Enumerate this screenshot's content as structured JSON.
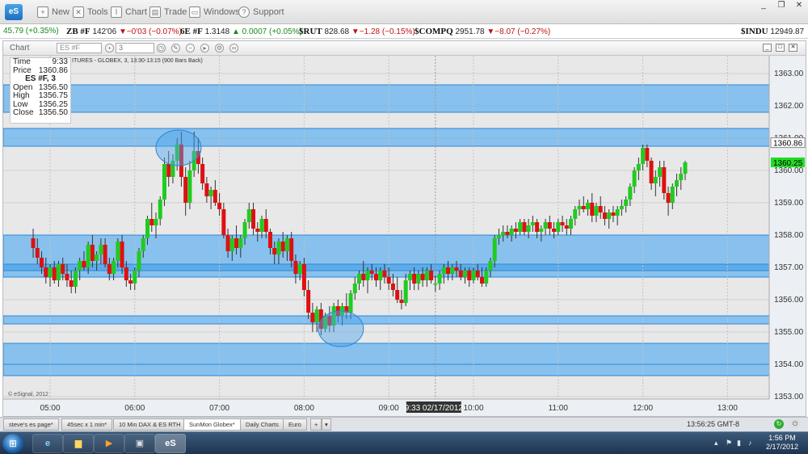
{
  "app": {
    "logo_text": "eS"
  },
  "toolbar": {
    "items": [
      {
        "label": "New",
        "icon": "new-file-icon"
      },
      {
        "label": "Tools",
        "icon": "tools-icon"
      },
      {
        "label": "Chart",
        "icon": "chart-icon"
      },
      {
        "label": "Trade",
        "icon": "trade-icon"
      },
      {
        "label": "Windows",
        "icon": "windows-icon"
      },
      {
        "label": "Support",
        "icon": "help-icon"
      }
    ]
  },
  "ticker": [
    {
      "symbol": "",
      "last": "",
      "change": "45.79 (+0.35%)",
      "dir": "up"
    },
    {
      "symbol": "ZB #F",
      "last": "142'06",
      "change": "▼−0'03 (−0.07%)",
      "dir": "dn"
    },
    {
      "symbol": "6E #F",
      "last": "1.3148",
      "change": "▲ 0.0007 (+0.05%)",
      "dir": "up"
    },
    {
      "symbol": "$RUT",
      "last": "828.68",
      "change": "▼−1.28 (−0.15%)",
      "dir": "dn"
    },
    {
      "symbol": "$COMPQ",
      "last": "2951.78",
      "change": "▼−8.07 (−0.27%)",
      "dir": "dn"
    },
    {
      "symbol": "$INDU",
      "last": "12949.87",
      "change": "",
      "dir": "up"
    }
  ],
  "chart_window": {
    "title": "Chart",
    "symbol": "ES #F",
    "interval": "3",
    "subtitle": "ITURES - GLOBEX, 3, 13:30-13:15 (900 Bars Back)",
    "copyright": "© eSignal, 2012",
    "cursor_label": "9:33 02/17/2012",
    "last_price_label": "1360.25",
    "cursor_price_label": "1360.86"
  },
  "databox": {
    "time_label": "Time",
    "time": "9:33",
    "price_label": "Price",
    "price": "1360.86",
    "header": "ES #F, 3",
    "open_label": "Open",
    "open": "1356.50",
    "high_label": "High",
    "high": "1356.75",
    "low_label": "Low",
    "low": "1356.25",
    "close_label": "Close",
    "close": "1356.50"
  },
  "tabs": [
    {
      "label": "steve's es page*",
      "active": false
    },
    {
      "label": "45sec x 1 min*",
      "active": false
    },
    {
      "label": "10 Min DAX & ES RTH",
      "active": false
    },
    {
      "label": "SunMon Globex*",
      "active": true
    },
    {
      "label": "Daily Charts",
      "active": false
    },
    {
      "label": "Euro",
      "active": false
    }
  ],
  "status": {
    "clock": "13:56:25 GMT-8"
  },
  "taskbar": {
    "time": "1:56 PM",
    "date": "2/17/2012"
  },
  "colors": {
    "up": "#1fcc1f",
    "down": "#dd1111",
    "zone": "#62b1ef",
    "zone_dark": "#3d9be8",
    "price_green": "#22dd22"
  },
  "chart_data": {
    "type": "candlestick",
    "x_ticks": [
      "05:00",
      "06:00",
      "07:00",
      "08:00",
      "09:00",
      "10:00",
      "11:00",
      "12:00",
      "13:00"
    ],
    "y_ticks": [
      "1353.00",
      "1354.00",
      "1355.00",
      "1356.00",
      "1357.00",
      "1358.00",
      "1359.00",
      "1360.00",
      "1361.00",
      "1362.00",
      "1363.00"
    ],
    "ylim": [
      1352.75,
      1363.5
    ],
    "zones": [
      [
        1361.8,
        1362.65
      ],
      [
        1360.75,
        1361.3
      ],
      [
        1356.7,
        1358.0
      ],
      [
        1356.9,
        1357.1
      ],
      [
        1355.25,
        1355.5
      ],
      [
        1354.0,
        1354.65
      ],
      [
        1353.65,
        1354.0
      ]
    ],
    "circles": [
      {
        "t": "06:31",
        "price": 1360.7
      },
      {
        "t": "08:26",
        "price": 1355.1
      }
    ],
    "candles": [
      [
        "04:48",
        1357.9,
        1358.2,
        1357.3,
        1357.6
      ],
      [
        "04:51",
        1357.6,
        1357.9,
        1357.1,
        1357.3
      ],
      [
        "04:54",
        1357.3,
        1357.5,
        1356.8,
        1357.0
      ],
      [
        "04:57",
        1357.0,
        1357.3,
        1356.5,
        1356.7
      ],
      [
        "05:00",
        1356.7,
        1357.1,
        1356.4,
        1357.0
      ],
      [
        "05:03",
        1357.0,
        1357.2,
        1356.5,
        1356.6
      ],
      [
        "05:06",
        1356.6,
        1357.2,
        1356.4,
        1357.1
      ],
      [
        "05:09",
        1357.1,
        1357.3,
        1356.6,
        1356.8
      ],
      [
        "05:12",
        1356.8,
        1357.1,
        1356.4,
        1356.6
      ],
      [
        "05:15",
        1356.6,
        1356.9,
        1356.2,
        1356.4
      ],
      [
        "05:18",
        1356.4,
        1357.0,
        1356.2,
        1356.9
      ],
      [
        "05:21",
        1356.9,
        1357.3,
        1356.6,
        1357.2
      ],
      [
        "05:24",
        1357.2,
        1357.5,
        1356.9,
        1357.0
      ],
      [
        "05:27",
        1357.0,
        1357.8,
        1356.8,
        1357.7
      ],
      [
        "05:30",
        1357.7,
        1358.0,
        1357.0,
        1357.2
      ],
      [
        "05:33",
        1357.2,
        1357.5,
        1356.9,
        1357.4
      ],
      [
        "05:36",
        1357.4,
        1357.9,
        1357.1,
        1357.7
      ],
      [
        "05:39",
        1357.7,
        1357.9,
        1357.0,
        1357.1
      ],
      [
        "05:42",
        1357.1,
        1357.3,
        1356.6,
        1356.8
      ],
      [
        "05:45",
        1356.8,
        1357.3,
        1356.6,
        1357.2
      ],
      [
        "05:48",
        1357.2,
        1357.9,
        1357.0,
        1357.8
      ],
      [
        "05:51",
        1357.8,
        1358.0,
        1356.8,
        1357.0
      ],
      [
        "05:54",
        1357.0,
        1357.2,
        1356.4,
        1356.6
      ],
      [
        "05:57",
        1356.6,
        1356.8,
        1356.3,
        1356.5
      ],
      [
        "06:00",
        1356.5,
        1357.0,
        1356.3,
        1356.9
      ],
      [
        "06:03",
        1356.9,
        1357.6,
        1356.7,
        1357.5
      ],
      [
        "06:06",
        1357.5,
        1358.0,
        1357.3,
        1357.9
      ],
      [
        "06:09",
        1357.9,
        1358.6,
        1357.7,
        1358.5
      ],
      [
        "06:12",
        1358.5,
        1359.0,
        1358.1,
        1358.3
      ],
      [
        "06:15",
        1358.3,
        1358.7,
        1357.9,
        1358.5
      ],
      [
        "06:18",
        1358.5,
        1359.2,
        1358.3,
        1359.1
      ],
      [
        "06:21",
        1359.1,
        1360.4,
        1358.9,
        1360.2
      ],
      [
        "06:24",
        1360.2,
        1360.6,
        1359.5,
        1359.8
      ],
      [
        "06:27",
        1359.8,
        1360.5,
        1359.6,
        1360.3
      ],
      [
        "06:30",
        1360.3,
        1361.0,
        1360.0,
        1360.8
      ],
      [
        "06:33",
        1360.8,
        1361.2,
        1359.5,
        1359.8
      ],
      [
        "06:36",
        1359.8,
        1360.1,
        1358.6,
        1359.0
      ],
      [
        "06:39",
        1359.0,
        1360.3,
        1358.8,
        1360.0
      ],
      [
        "06:42",
        1360.0,
        1361.2,
        1359.8,
        1360.6
      ],
      [
        "06:45",
        1360.6,
        1361.0,
        1359.9,
        1360.2
      ],
      [
        "06:48",
        1360.2,
        1360.4,
        1359.4,
        1359.6
      ],
      [
        "06:51",
        1359.6,
        1359.8,
        1359.0,
        1359.2
      ],
      [
        "06:54",
        1359.2,
        1359.5,
        1358.8,
        1359.4
      ],
      [
        "06:57",
        1359.4,
        1359.7,
        1358.9,
        1359.0
      ],
      [
        "07:00",
        1359.0,
        1359.3,
        1358.6,
        1358.8
      ],
      [
        "07:03",
        1358.8,
        1359.0,
        1357.9,
        1358.0
      ],
      [
        "07:06",
        1358.0,
        1358.2,
        1357.3,
        1357.5
      ],
      [
        "07:09",
        1357.5,
        1358.0,
        1357.2,
        1357.9
      ],
      [
        "07:12",
        1357.9,
        1358.3,
        1357.4,
        1357.6
      ],
      [
        "07:15",
        1357.6,
        1358.0,
        1357.3,
        1357.9
      ],
      [
        "07:18",
        1357.9,
        1358.5,
        1357.7,
        1358.4
      ],
      [
        "07:21",
        1358.4,
        1359.0,
        1358.2,
        1358.8
      ],
      [
        "07:24",
        1358.8,
        1359.0,
        1358.0,
        1358.2
      ],
      [
        "07:27",
        1358.2,
        1358.4,
        1357.8,
        1358.1
      ],
      [
        "07:30",
        1358.1,
        1358.6,
        1357.9,
        1358.5
      ],
      [
        "07:33",
        1358.5,
        1358.8,
        1357.9,
        1358.1
      ],
      [
        "07:36",
        1358.1,
        1358.2,
        1357.4,
        1357.6
      ],
      [
        "07:39",
        1357.6,
        1357.8,
        1357.1,
        1357.4
      ],
      [
        "07:42",
        1357.4,
        1357.9,
        1357.1,
        1357.8
      ],
      [
        "07:45",
        1357.8,
        1358.1,
        1357.3,
        1357.5
      ],
      [
        "07:48",
        1357.5,
        1358.0,
        1357.2,
        1357.9
      ],
      [
        "07:51",
        1357.9,
        1358.1,
        1357.0,
        1357.2
      ],
      [
        "07:54",
        1357.2,
        1357.4,
        1356.5,
        1356.8
      ],
      [
        "07:57",
        1356.8,
        1357.2,
        1356.6,
        1357.1
      ],
      [
        "08:00",
        1357.1,
        1357.3,
        1356.1,
        1356.3
      ],
      [
        "08:03",
        1356.3,
        1356.6,
        1355.4,
        1355.6
      ],
      [
        "08:06",
        1355.6,
        1355.9,
        1355.0,
        1355.3
      ],
      [
        "08:09",
        1355.3,
        1355.8,
        1355.0,
        1355.7
      ],
      [
        "08:12",
        1355.7,
        1355.9,
        1354.9,
        1355.1
      ],
      [
        "08:15",
        1355.1,
        1355.6,
        1355.0,
        1355.5
      ],
      [
        "08:18",
        1355.5,
        1355.8,
        1355.0,
        1355.2
      ],
      [
        "08:21",
        1355.2,
        1355.9,
        1355.0,
        1355.8
      ],
      [
        "08:24",
        1355.8,
        1356.0,
        1355.3,
        1355.5
      ],
      [
        "08:27",
        1355.5,
        1355.9,
        1355.2,
        1355.8
      ],
      [
        "08:30",
        1355.8,
        1356.2,
        1355.4,
        1355.6
      ],
      [
        "08:33",
        1355.6,
        1356.3,
        1355.4,
        1356.2
      ],
      [
        "08:36",
        1356.2,
        1356.7,
        1356.0,
        1356.5
      ],
      [
        "08:39",
        1356.5,
        1356.9,
        1356.3,
        1356.8
      ],
      [
        "08:42",
        1356.8,
        1357.2,
        1356.4,
        1356.6
      ],
      [
        "08:45",
        1356.6,
        1357.0,
        1356.2,
        1356.9
      ],
      [
        "08:48",
        1356.9,
        1357.1,
        1356.6,
        1356.8
      ],
      [
        "08:51",
        1356.8,
        1357.0,
        1356.4,
        1356.6
      ],
      [
        "08:54",
        1356.6,
        1357.0,
        1356.3,
        1356.9
      ],
      [
        "08:57",
        1356.9,
        1357.1,
        1356.5,
        1356.7
      ],
      [
        "09:00",
        1356.7,
        1357.0,
        1356.3,
        1356.5
      ],
      [
        "09:03",
        1356.5,
        1356.8,
        1356.1,
        1356.3
      ],
      [
        "09:06",
        1356.3,
        1356.7,
        1355.9,
        1356.0
      ],
      [
        "09:09",
        1356.0,
        1356.3,
        1355.7,
        1355.9
      ],
      [
        "09:12",
        1355.9,
        1356.8,
        1355.8,
        1356.6
      ],
      [
        "09:15",
        1356.6,
        1356.9,
        1356.3,
        1356.8
      ],
      [
        "09:18",
        1356.8,
        1357.0,
        1356.3,
        1356.5
      ],
      [
        "09:21",
        1356.5,
        1356.9,
        1356.3,
        1356.8
      ],
      [
        "09:24",
        1356.8,
        1357.0,
        1356.4,
        1356.6
      ],
      [
        "09:27",
        1356.6,
        1357.0,
        1356.4,
        1356.9
      ],
      [
        "09:30",
        1356.9,
        1357.1,
        1356.5,
        1356.6
      ],
      [
        "09:33",
        1356.5,
        1356.75,
        1356.25,
        1356.5
      ],
      [
        "09:36",
        1356.5,
        1356.9,
        1356.3,
        1356.8
      ],
      [
        "09:39",
        1356.8,
        1357.1,
        1356.5,
        1357.0
      ],
      [
        "09:42",
        1357.0,
        1357.2,
        1356.6,
        1356.8
      ],
      [
        "09:45",
        1356.8,
        1357.1,
        1356.6,
        1357.0
      ],
      [
        "09:48",
        1357.0,
        1357.2,
        1356.7,
        1356.9
      ],
      [
        "09:51",
        1356.9,
        1357.1,
        1356.6,
        1356.7
      ],
      [
        "09:54",
        1356.7,
        1357.0,
        1356.5,
        1356.9
      ],
      [
        "09:57",
        1356.9,
        1357.0,
        1356.4,
        1356.6
      ],
      [
        "10:00",
        1356.6,
        1357.0,
        1356.5,
        1356.9
      ],
      [
        "10:03",
        1356.9,
        1357.1,
        1356.6,
        1356.7
      ],
      [
        "10:06",
        1356.7,
        1357.0,
        1356.4,
        1356.5
      ],
      [
        "10:09",
        1356.5,
        1357.0,
        1356.4,
        1356.9
      ],
      [
        "10:12",
        1356.9,
        1357.3,
        1356.7,
        1357.2
      ],
      [
        "10:15",
        1357.2,
        1358.0,
        1357.0,
        1357.9
      ],
      [
        "10:18",
        1357.9,
        1358.2,
        1357.7,
        1358.0
      ],
      [
        "10:21",
        1358.0,
        1358.3,
        1357.8,
        1358.1
      ],
      [
        "10:24",
        1358.1,
        1358.3,
        1357.9,
        1358.0
      ],
      [
        "10:27",
        1358.0,
        1358.3,
        1357.8,
        1358.2
      ],
      [
        "10:30",
        1358.2,
        1358.4,
        1357.9,
        1358.1
      ],
      [
        "10:33",
        1358.1,
        1358.5,
        1358.0,
        1358.4
      ],
      [
        "10:36",
        1358.4,
        1358.5,
        1358.0,
        1358.1
      ],
      [
        "10:39",
        1358.1,
        1358.5,
        1357.9,
        1358.3
      ],
      [
        "10:42",
        1358.3,
        1358.6,
        1358.1,
        1358.4
      ],
      [
        "10:45",
        1358.4,
        1358.5,
        1357.9,
        1358.1
      ],
      [
        "10:48",
        1358.1,
        1358.3,
        1357.8,
        1358.2
      ],
      [
        "10:51",
        1358.2,
        1358.5,
        1358.0,
        1358.4
      ],
      [
        "10:54",
        1358.4,
        1358.6,
        1358.0,
        1358.2
      ],
      [
        "10:57",
        1358.2,
        1358.4,
        1357.9,
        1358.1
      ],
      [
        "11:00",
        1358.1,
        1358.5,
        1358.0,
        1358.4
      ],
      [
        "11:03",
        1358.4,
        1358.6,
        1358.1,
        1358.3
      ],
      [
        "11:06",
        1358.3,
        1358.5,
        1358.0,
        1358.2
      ],
      [
        "11:09",
        1358.2,
        1358.6,
        1358.0,
        1358.5
      ],
      [
        "11:12",
        1358.5,
        1358.9,
        1358.3,
        1358.8
      ],
      [
        "11:15",
        1358.8,
        1359.1,
        1358.6,
        1358.9
      ],
      [
        "11:18",
        1358.9,
        1359.2,
        1358.7,
        1358.8
      ],
      [
        "11:21",
        1358.8,
        1359.1,
        1358.6,
        1359.0
      ],
      [
        "11:24",
        1359.0,
        1359.3,
        1358.4,
        1358.6
      ],
      [
        "11:27",
        1358.6,
        1359.0,
        1358.4,
        1358.9
      ],
      [
        "11:30",
        1358.9,
        1359.2,
        1358.5,
        1358.7
      ],
      [
        "11:33",
        1358.7,
        1358.9,
        1358.3,
        1358.5
      ],
      [
        "11:36",
        1358.5,
        1358.8,
        1358.2,
        1358.7
      ],
      [
        "11:39",
        1358.7,
        1358.9,
        1358.4,
        1358.6
      ],
      [
        "11:42",
        1358.6,
        1358.9,
        1358.3,
        1358.8
      ],
      [
        "11:45",
        1358.8,
        1359.1,
        1358.6,
        1358.9
      ],
      [
        "11:48",
        1358.9,
        1359.2,
        1358.7,
        1359.1
      ],
      [
        "11:51",
        1359.1,
        1359.6,
        1358.9,
        1359.5
      ],
      [
        "11:54",
        1359.5,
        1360.1,
        1359.3,
        1360.0
      ],
      [
        "11:57",
        1360.0,
        1360.4,
        1359.7,
        1360.2
      ],
      [
        "12:00",
        1360.2,
        1360.8,
        1360.0,
        1360.7
      ],
      [
        "12:03",
        1360.7,
        1360.8,
        1360.1,
        1360.3
      ],
      [
        "12:06",
        1360.3,
        1360.4,
        1359.4,
        1359.6
      ],
      [
        "12:09",
        1359.6,
        1360.0,
        1359.2,
        1359.8
      ],
      [
        "12:12",
        1359.8,
        1360.3,
        1359.5,
        1360.1
      ],
      [
        "12:15",
        1360.1,
        1360.3,
        1359.1,
        1359.3
      ],
      [
        "12:18",
        1359.3,
        1359.5,
        1358.6,
        1359.0
      ],
      [
        "12:21",
        1359.0,
        1359.6,
        1358.8,
        1359.5
      ],
      [
        "12:24",
        1359.5,
        1359.9,
        1359.2,
        1359.7
      ],
      [
        "12:27",
        1359.7,
        1360.1,
        1359.4,
        1359.9
      ],
      [
        "12:30",
        1359.9,
        1360.3,
        1359.7,
        1360.25
      ]
    ]
  }
}
